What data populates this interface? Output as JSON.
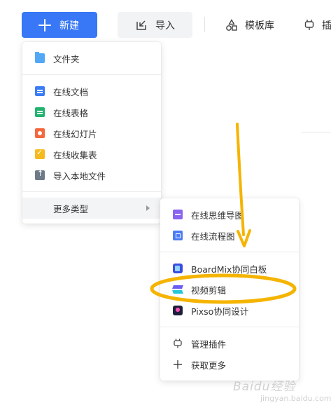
{
  "toolbar": {
    "new_label": "新建",
    "import_label": "导入",
    "template_label": "模板库",
    "plugin_label_partial": "插"
  },
  "main_menu": {
    "items": [
      {
        "label": "文件夹",
        "icon": "folder-icon"
      },
      {
        "label": "在线文档",
        "icon": "doc-icon"
      },
      {
        "label": "在线表格",
        "icon": "sheet-icon"
      },
      {
        "label": "在线幻灯片",
        "icon": "slides-icon"
      },
      {
        "label": "在线收集表",
        "icon": "form-icon"
      },
      {
        "label": "导入本地文件",
        "icon": "upload-icon"
      },
      {
        "label": "更多类型",
        "icon": "chevron-right-icon"
      }
    ]
  },
  "sub_menu": {
    "items": [
      {
        "label": "在线思维导图",
        "icon": "mindmap-icon"
      },
      {
        "label": "在线流程图",
        "icon": "flowchart-icon"
      },
      {
        "label": "BoardMix协同白板",
        "icon": "boardmix-icon"
      },
      {
        "label": "视频剪辑",
        "icon": "video-edit-icon"
      },
      {
        "label": "Pixso协同设计",
        "icon": "pixso-icon"
      },
      {
        "label": "管理插件",
        "icon": "plugin-icon"
      },
      {
        "label": "获取更多",
        "icon": "plus-icon"
      }
    ]
  },
  "annotation": {
    "highlight_color": "#f5b400",
    "target_item": "视频剪辑"
  },
  "watermark": {
    "brand": "Baidu经验",
    "url": "jingyan.baidu.com"
  },
  "colors": {
    "primary": "#3877f5",
    "menu_bg": "#ffffff",
    "hover_bg": "#f3f4f6"
  }
}
